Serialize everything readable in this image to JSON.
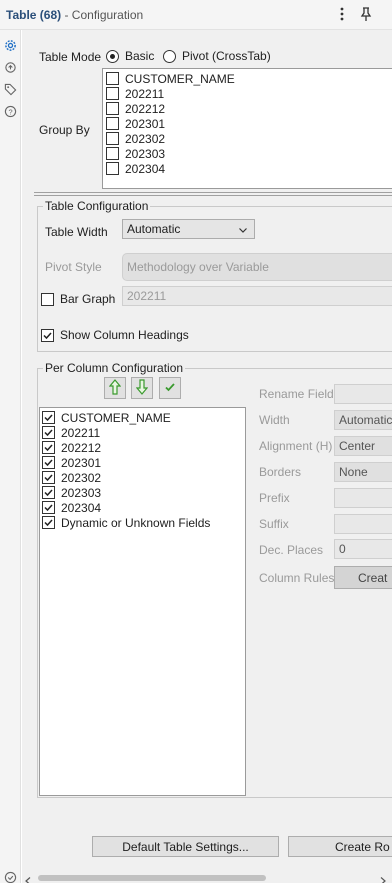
{
  "header": {
    "tool_name": "Table (68)",
    "subtitle": "- Configuration",
    "more_icon": "more-vertical-icon",
    "pin_icon": "pin-icon"
  },
  "rail": {
    "icons": [
      "gear-icon",
      "cycle-icon",
      "tag-icon",
      "help-icon",
      "check-circle-icon"
    ]
  },
  "table_mode": {
    "label": "Table Mode",
    "options": [
      "Basic",
      "Pivot (CrossTab)"
    ],
    "selected": "Basic"
  },
  "group_by": {
    "label": "Group By",
    "items": [
      "CUSTOMER_NAME",
      "202211",
      "202212",
      "202301",
      "202302",
      "202303",
      "202304"
    ]
  },
  "table_config": {
    "title": "Table Configuration",
    "width_label": "Table Width",
    "width_value": "Automatic",
    "pivot_label": "Pivot Style",
    "pivot_value": "Methodology over Variable",
    "bar_graph_label": "Bar Graph",
    "bar_graph_value": "202211",
    "show_headings_label": "Show Column Headings",
    "show_headings_checked": true
  },
  "per_column": {
    "title": "Per Column Configuration",
    "tool_buttons": [
      "arrow-up-icon",
      "arrow-down-icon",
      "checkmark-icon"
    ],
    "fields": [
      "CUSTOMER_NAME",
      "202211",
      "202212",
      "202301",
      "202302",
      "202303",
      "202304",
      "Dynamic or Unknown Fields"
    ],
    "props": {
      "rename_label": "Rename Field",
      "width_label": "Width",
      "width_value": "Automatic",
      "alignment_label": "Alignment (H)",
      "alignment_value": "Center",
      "borders_label": "Borders",
      "borders_value": "None",
      "prefix_label": "Prefix",
      "suffix_label": "Suffix",
      "dec_places_label": "Dec. Places",
      "dec_places_value": "0",
      "column_rules_label": "Column Rules",
      "create_label": "Creat"
    }
  },
  "footer": {
    "default_settings": "Default Table Settings...",
    "create_rows": "Create Ro"
  },
  "colors": {
    "accent": "#2b4f7a",
    "panel_bg": "#f0f0f0",
    "arrow_green": "#3a9a2e"
  }
}
